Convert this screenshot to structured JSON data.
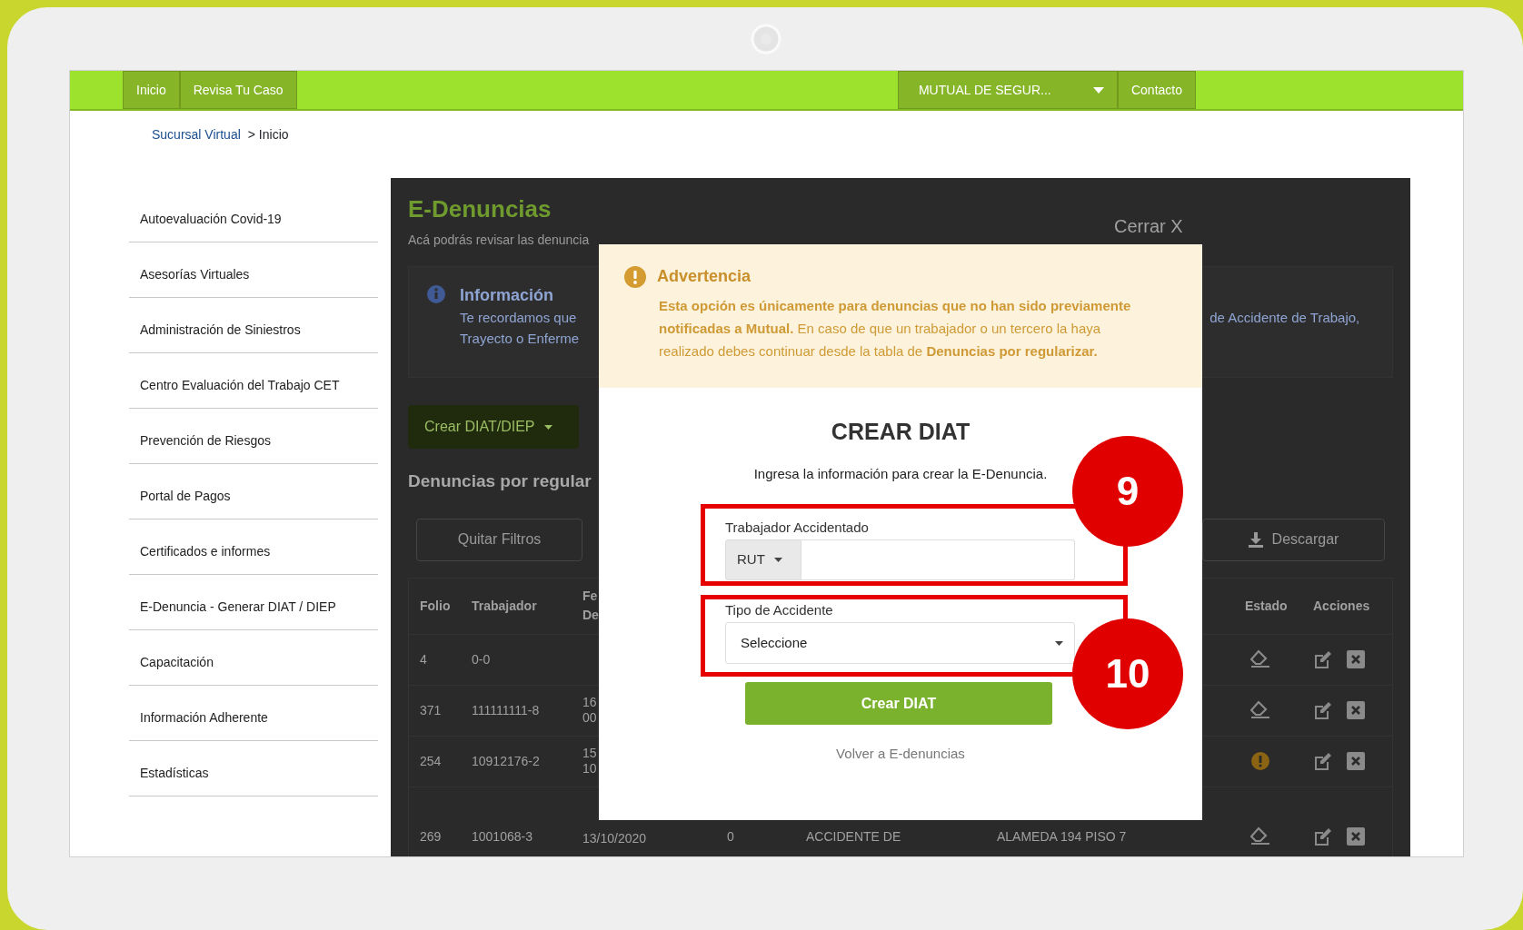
{
  "nav": {
    "items": [
      {
        "label": "Inicio"
      },
      {
        "label": "Revisa Tu Caso"
      }
    ],
    "company_dropdown": "MUTUAL DE SEGUR...",
    "contact": "Contacto"
  },
  "breadcrumb": {
    "link": "Sucursal Virtual",
    "current": "> Inicio"
  },
  "sidebar": {
    "items": [
      {
        "label": "Autoevaluación Covid-19"
      },
      {
        "label": "Asesorías Virtuales"
      },
      {
        "label": "Administración de Siniestros"
      },
      {
        "label": "Centro Evaluación del Trabajo CET"
      },
      {
        "label": "Prevención de Riesgos"
      },
      {
        "label": "Portal de Pagos"
      },
      {
        "label": "Certificados e informes"
      },
      {
        "label": "E-Denuncia - Generar DIAT / DIEP"
      },
      {
        "label": "Capacitación"
      },
      {
        "label": "Información Adherente"
      },
      {
        "label": "Estadísticas"
      }
    ]
  },
  "background": {
    "title": "E-Denuncias",
    "intro": "Acá podrás revisar las denuncia",
    "close": "Cerrar X",
    "info": {
      "title": "Información",
      "lines": [
        "Te recordamos que",
        "Trayecto o Enferme"
      ],
      "right_text": "de Accidente de Trabajo,"
    },
    "create_button": "Crear DIAT/DIEP",
    "section_title": "Denuncias por regular",
    "clear_filters": "Quitar Filtros",
    "download": "Descargar",
    "table": {
      "columns": [
        {
          "lines": [
            "Folio"
          ]
        },
        {
          "lines": [
            "Trabajador"
          ]
        },
        {
          "lines": [
            "Fe",
            "De"
          ]
        },
        {
          "lines": [
            "Estado"
          ]
        },
        {
          "lines": [
            "Acciones"
          ]
        }
      ],
      "rows": [
        {
          "folio": "4",
          "worker": "0-0",
          "date": [],
          "kind": "eraser"
        },
        {
          "folio": "371",
          "worker": "111111111-8",
          "date": [
            "16",
            "00"
          ],
          "kind": "eraser"
        },
        {
          "folio": "254",
          "worker": "10912176-2",
          "date": [
            "15",
            "10"
          ],
          "kind": "warning"
        },
        {
          "folio": "269",
          "worker": "1001068-3",
          "date": [
            "13/10/2020"
          ],
          "column_4": "0",
          "column_5": "ACCIDENTE DE",
          "column_6": "ALAMEDA 194 PISO 7",
          "kind": "eraser"
        }
      ]
    }
  },
  "modal": {
    "warning_title": "Advertencia",
    "warning_text": "**Esta opción es únicamente para denuncias que no han sido previamente notificadas a Mutual.** En caso de que un trabajador o un tercero la haya realizado debes continuar desde la tabla de **Denuncias por regularizar.**",
    "title": "CREAR DIAT",
    "subtitle": "Ingresa la información para crear la E-Denuncia.",
    "worker_label": "Trabajador Accidentado",
    "id_type": "RUT",
    "type_label": "Tipo de Accidente",
    "type_value": "Seleccione",
    "submit": "Crear DIAT",
    "back_link": "Volver a E-denuncias"
  },
  "annotations": [
    {
      "number": "9"
    },
    {
      "number": "10"
    }
  ]
}
